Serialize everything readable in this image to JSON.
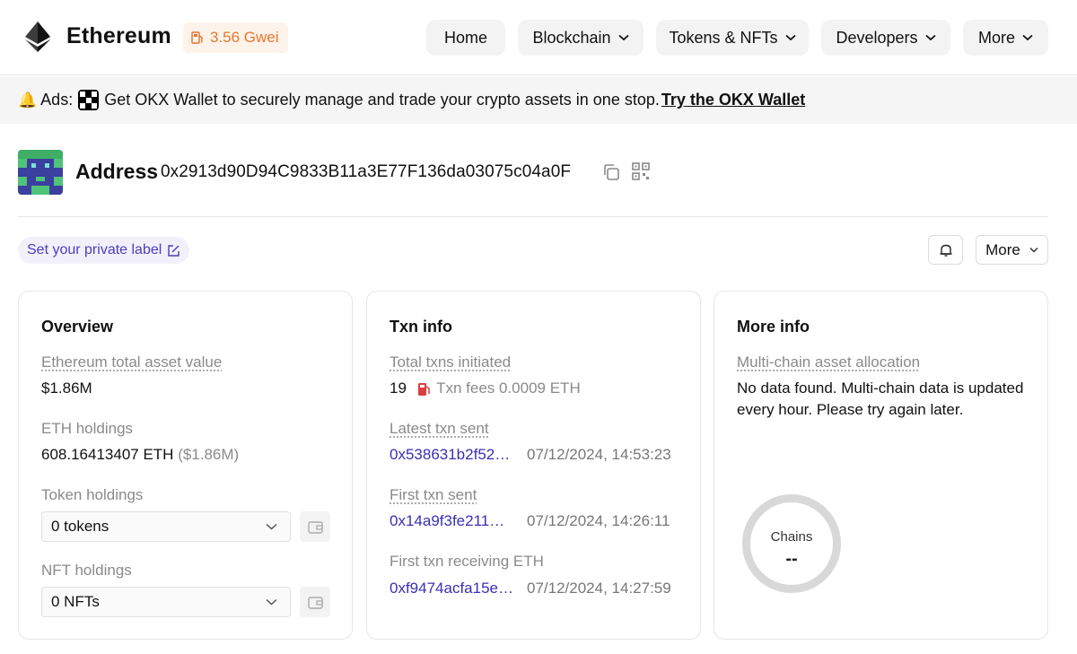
{
  "header": {
    "brand": "Ethereum",
    "gas": "3.56 Gwei",
    "nav": {
      "home": "Home",
      "blockchain": "Blockchain",
      "tokens_nfts": "Tokens & NFTs",
      "developers": "Developers",
      "more": "More"
    }
  },
  "ads": {
    "prefix": "Ads:",
    "text": "Get OKX Wallet to securely manage and trade your crypto assets in one stop.",
    "link": "Try the OKX Wallet"
  },
  "address": {
    "title": "Address",
    "hash": "0x2913d90D94C9833B11a3E77F136da03075c04a0F"
  },
  "actions": {
    "private_label": "Set your private label",
    "more": "More"
  },
  "overview": {
    "title": "Overview",
    "total_asset_label": "Ethereum total asset value",
    "total_asset_value": "$1.86M",
    "eth_holdings_label": "ETH holdings",
    "eth_holdings_value": "608.16413407 ETH",
    "eth_holdings_usd": "($1.86M)",
    "token_holdings_label": "Token holdings",
    "token_holdings_value": "0 tokens",
    "nft_holdings_label": "NFT holdings",
    "nft_holdings_value": "0 NFTs"
  },
  "txn_info": {
    "title": "Txn info",
    "total_label": "Total txns initiated",
    "total_value": "19",
    "fees_text": "Txn fees 0.0009 ETH",
    "latest_label": "Latest txn sent",
    "latest_hash": "0x538631b2f52…",
    "latest_time": "07/12/2024, 14:53:23",
    "first_label": "First txn sent",
    "first_hash": "0x14a9f3fe211…",
    "first_time": "07/12/2024, 14:26:11",
    "first_recv_label": "First txn receiving ETH",
    "first_recv_hash": "0xf9474acfa15e…",
    "first_recv_time": "07/12/2024, 14:27:59"
  },
  "more_info": {
    "title": "More info",
    "allocation_label": "Multi-chain asset allocation",
    "no_data": "No data found. Multi-chain data is updated every hour. Please try again later.",
    "chains_label": "Chains",
    "chains_value": "--"
  },
  "colors": {
    "accent_link": "#3a2fb4",
    "gas_orange": "#e8772e",
    "label_purple": "#4b3dbd"
  }
}
